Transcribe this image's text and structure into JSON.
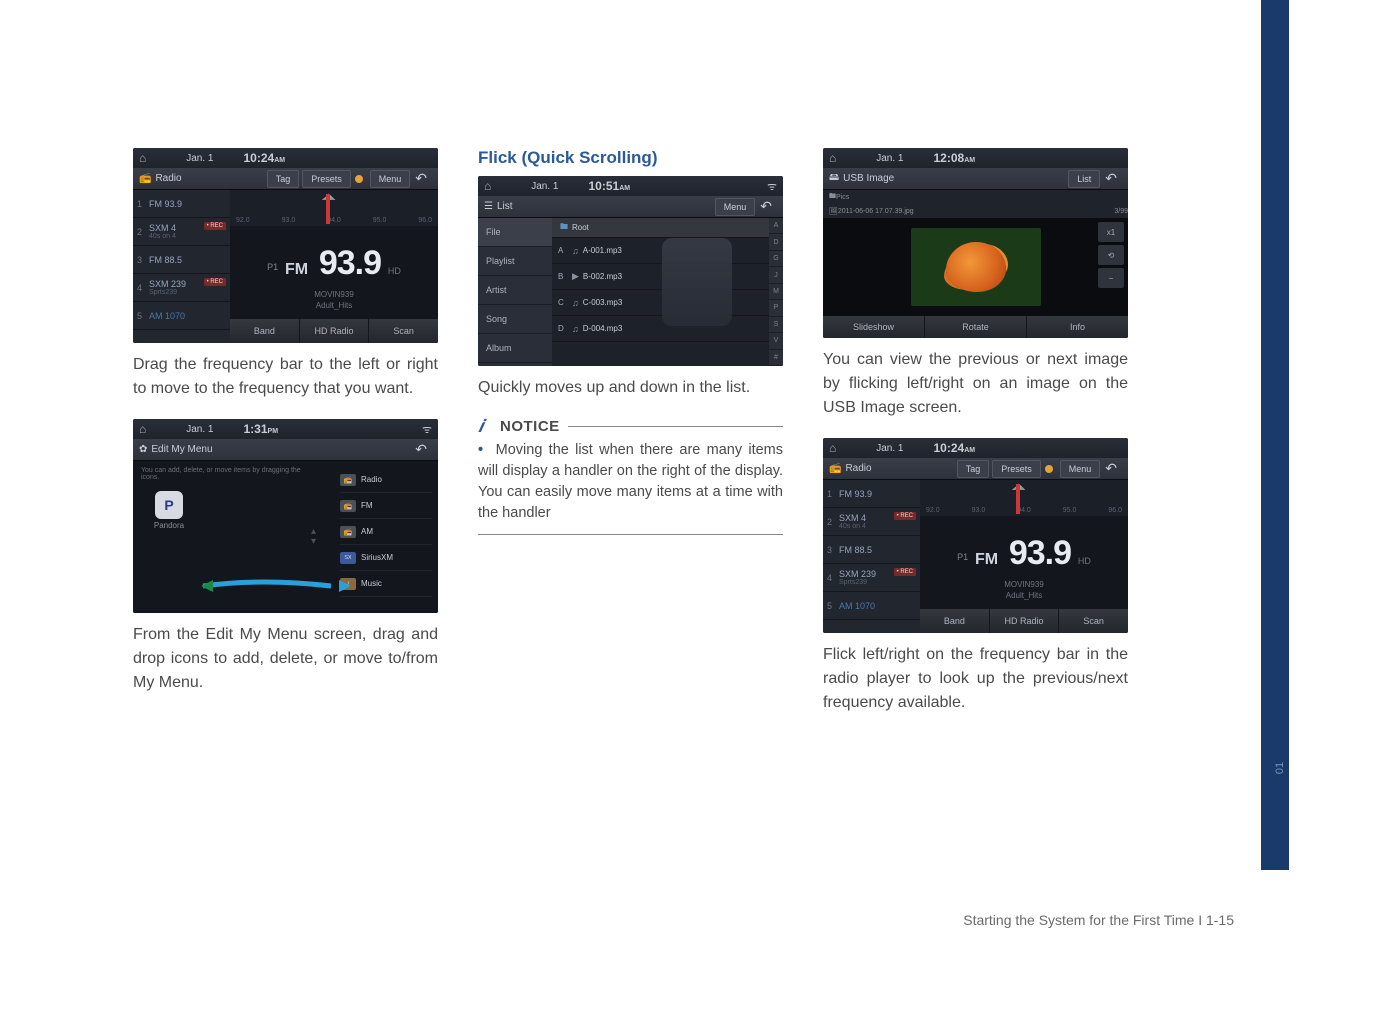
{
  "side_tab_number": "01",
  "col1": {
    "radio": {
      "date": "Jan.  1",
      "time": "10:24",
      "ampm": "AM",
      "title": "Radio",
      "tabs": {
        "tag": "Tag",
        "presets": "Presets",
        "menu": "Menu"
      },
      "presets": [
        {
          "n": "1",
          "label": "FM 93.9"
        },
        {
          "n": "2",
          "label": "SXM 4",
          "sub": "40s on 4",
          "rec": "• REC"
        },
        {
          "n": "3",
          "label": "FM 88.5"
        },
        {
          "n": "4",
          "label": "SXM 239",
          "sub": "Sprts239",
          "rec": "• REC"
        },
        {
          "n": "5",
          "label": "AM 1070",
          "am": true
        }
      ],
      "scale": [
        "92.0",
        "93.0",
        "94.0",
        "95.0",
        "96.0"
      ],
      "p_label": "P1",
      "band": "FM",
      "freq": "93.9",
      "hd": "HD",
      "station1": "MOVIN939",
      "station2": "Adult_Hits",
      "bottom": {
        "band": "Band",
        "hd": "HD Radio",
        "scan": "Scan"
      }
    },
    "caption1": "Drag the frequency bar to the left or right to move to the frequency that you want.",
    "editmenu": {
      "date": "Jan.  1",
      "time": "1:31",
      "ampm": "PM",
      "title": "Edit My Menu",
      "hint": "You can add, delete, or move items by dragging the icons.",
      "icon_letter": "P",
      "icon_label": "Pandora",
      "list": [
        {
          "label": "Radio"
        },
        {
          "label": "FM"
        },
        {
          "label": "AM"
        },
        {
          "label": "SiriusXM"
        },
        {
          "label": "Music"
        }
      ]
    },
    "caption2": "From the Edit My Menu screen, drag and drop icons to add, delete, or move to/from My Menu."
  },
  "col2": {
    "heading": "Flick (Quick Scrolling)",
    "list": {
      "date": "Jan.  1",
      "time": "10:51",
      "ampm": "AM",
      "title": "List",
      "menu": "Menu",
      "left": [
        "File",
        "Playlist",
        "Artist",
        "Song",
        "Album"
      ],
      "root": "Root",
      "rows": [
        {
          "k": "A",
          "icon": "note",
          "name": "A-001.mp3"
        },
        {
          "k": "B",
          "icon": "play",
          "name": "B-002.mp3"
        },
        {
          "k": "C",
          "icon": "note",
          "name": "C-003.mp3"
        },
        {
          "k": "D",
          "icon": "note",
          "name": "D-004.mp3"
        }
      ],
      "index": [
        "A",
        "D",
        "G",
        "J",
        "M",
        "P",
        "S",
        "V",
        "#"
      ]
    },
    "caption1": "Quickly moves up and down in the list.",
    "notice_label": "NOTICE",
    "notice_body": "Moving the list when there are many items will display a handler on the right of the display. You can easily move many items at a time with the handler"
  },
  "col3": {
    "usb": {
      "date": "Jan.  1",
      "time": "12:08",
      "ampm": "AM",
      "title": "USB Image",
      "list_btn": "List",
      "crumb1": "Pics",
      "crumb2": "2011-06-06 17.07.39.jpg",
      "counter": "3/99",
      "controls": {
        "zoom": "x1",
        "rotate": "⟲",
        "minus": "−"
      },
      "bottom": {
        "slideshow": "Slideshow",
        "rotate": "Rotate",
        "info": "Info"
      }
    },
    "caption1": "You can view the previous or next image by flicking left/right on an image on the USB Image screen.",
    "caption2": "Flick left/right on the frequency bar in the radio player to look up the previous/next frequency available."
  },
  "footer": "Starting the System for the First Time I 1-15"
}
